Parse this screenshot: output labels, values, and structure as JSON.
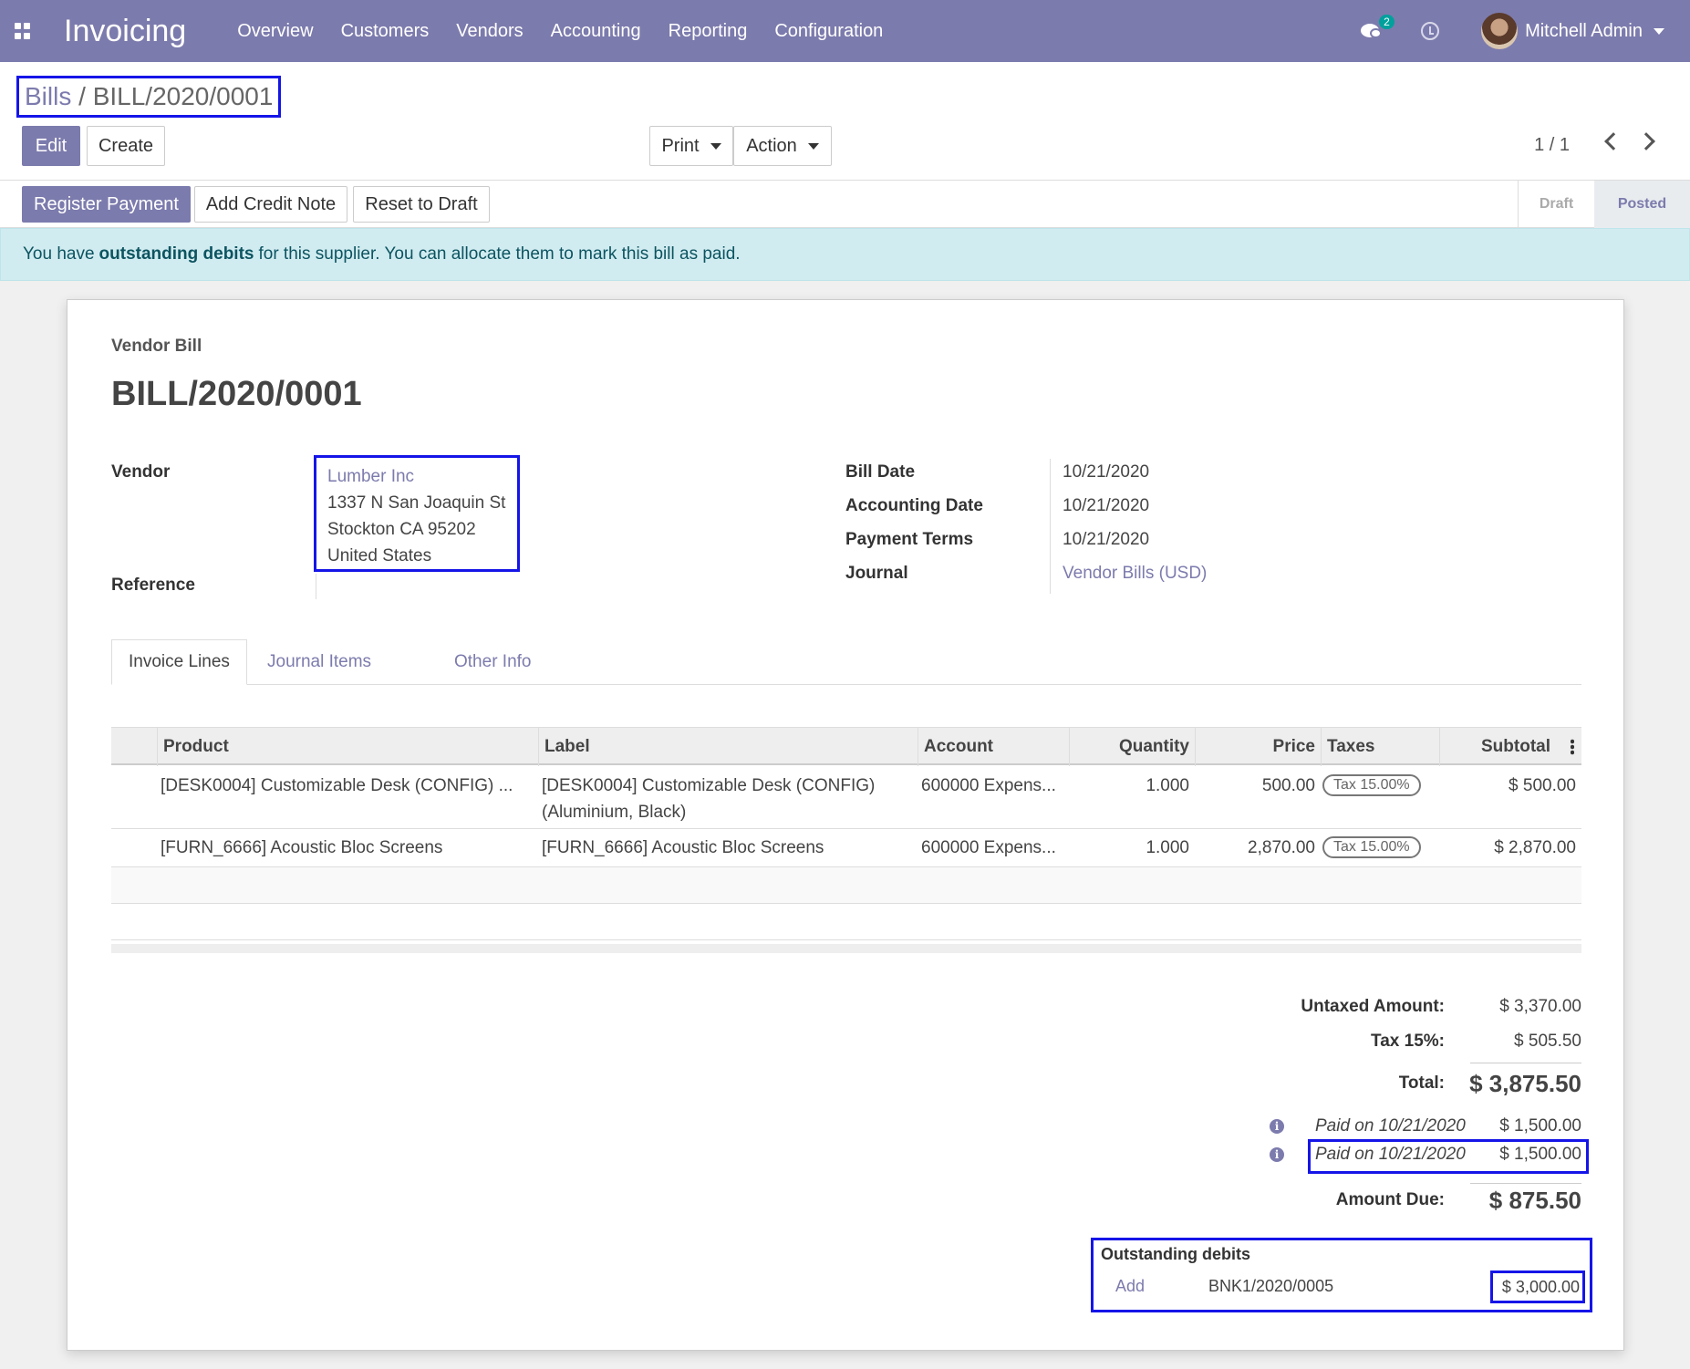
{
  "navbar": {
    "app_title": "Invoicing",
    "menu": [
      "Overview",
      "Customers",
      "Vendors",
      "Accounting",
      "Reporting",
      "Configuration"
    ],
    "chat_badge": "2",
    "user_name": "Mitchell Admin",
    "accent": "#7c7bad"
  },
  "breadcrumb": {
    "parent": "Bills",
    "separator": "/",
    "current": "BILL/2020/0001"
  },
  "toolbar": {
    "edit": "Edit",
    "create": "Create",
    "print": "Print",
    "action": "Action",
    "pager": "1 / 1"
  },
  "statusbar": {
    "register_payment": "Register Payment",
    "add_credit_note": "Add Credit Note",
    "reset_to_draft": "Reset to Draft",
    "stages": [
      "Draft",
      "Posted"
    ],
    "active_stage": "Posted"
  },
  "alert": {
    "prefix": "You have",
    "bold": "outstanding debits",
    "suffix": "for this supplier. You can allocate them to mark this bill as paid."
  },
  "document": {
    "type": "Vendor Bill",
    "title": "BILL/2020/0001",
    "vendor_label": "Vendor",
    "vendor_name": "Lumber Inc",
    "vendor_address": [
      "1337 N San Joaquin St",
      "Stockton CA 95202",
      "United States"
    ],
    "reference_label": "Reference",
    "fields": [
      {
        "label": "Bill Date",
        "value": "10/21/2020"
      },
      {
        "label": "Accounting Date",
        "value": "10/21/2020"
      },
      {
        "label": "Payment Terms",
        "value": "10/21/2020"
      },
      {
        "label": "Journal",
        "value": "Vendor Bills (USD)"
      }
    ]
  },
  "tabs": [
    "Invoice Lines",
    "Journal Items",
    "Other Info"
  ],
  "lines": {
    "headers": [
      "Product",
      "Label",
      "Account",
      "Quantity",
      "Price",
      "Taxes",
      "Subtotal"
    ],
    "rows": [
      {
        "product": "[DESK0004] Customizable Desk (CONFIG) ...",
        "label1": "[DESK0004] Customizable Desk (CONFIG)",
        "label2": "(Aluminium, Black)",
        "account": "600000 Expens...",
        "quantity": "1.000",
        "price": "500.00",
        "tax": "Tax 15.00%",
        "subtotal": "$ 500.00"
      },
      {
        "product": "[FURN_6666] Acoustic Bloc Screens",
        "label1": "[FURN_6666] Acoustic Bloc Screens",
        "label2": "",
        "account": "600000 Expens...",
        "quantity": "1.000",
        "price": "2,870.00",
        "tax": "Tax 15.00%",
        "subtotal": "$ 2,870.00"
      }
    ]
  },
  "totals": {
    "untaxed_label": "Untaxed Amount:",
    "untaxed": "$ 3,370.00",
    "tax_label": "Tax 15%:",
    "tax": "$ 505.50",
    "total_label": "Total:",
    "total": "$ 3,875.50",
    "payments": [
      {
        "label": "Paid on 10/21/2020",
        "amount": "$ 1,500.00"
      },
      {
        "label": "Paid on 10/21/2020",
        "amount": "$ 1,500.00"
      }
    ],
    "due_label": "Amount Due:",
    "due": "$ 875.50"
  },
  "outstanding": {
    "title": "Outstanding debits",
    "add": "Add",
    "ref": "BNK1/2020/0005",
    "amount": "$ 3,000.00"
  }
}
